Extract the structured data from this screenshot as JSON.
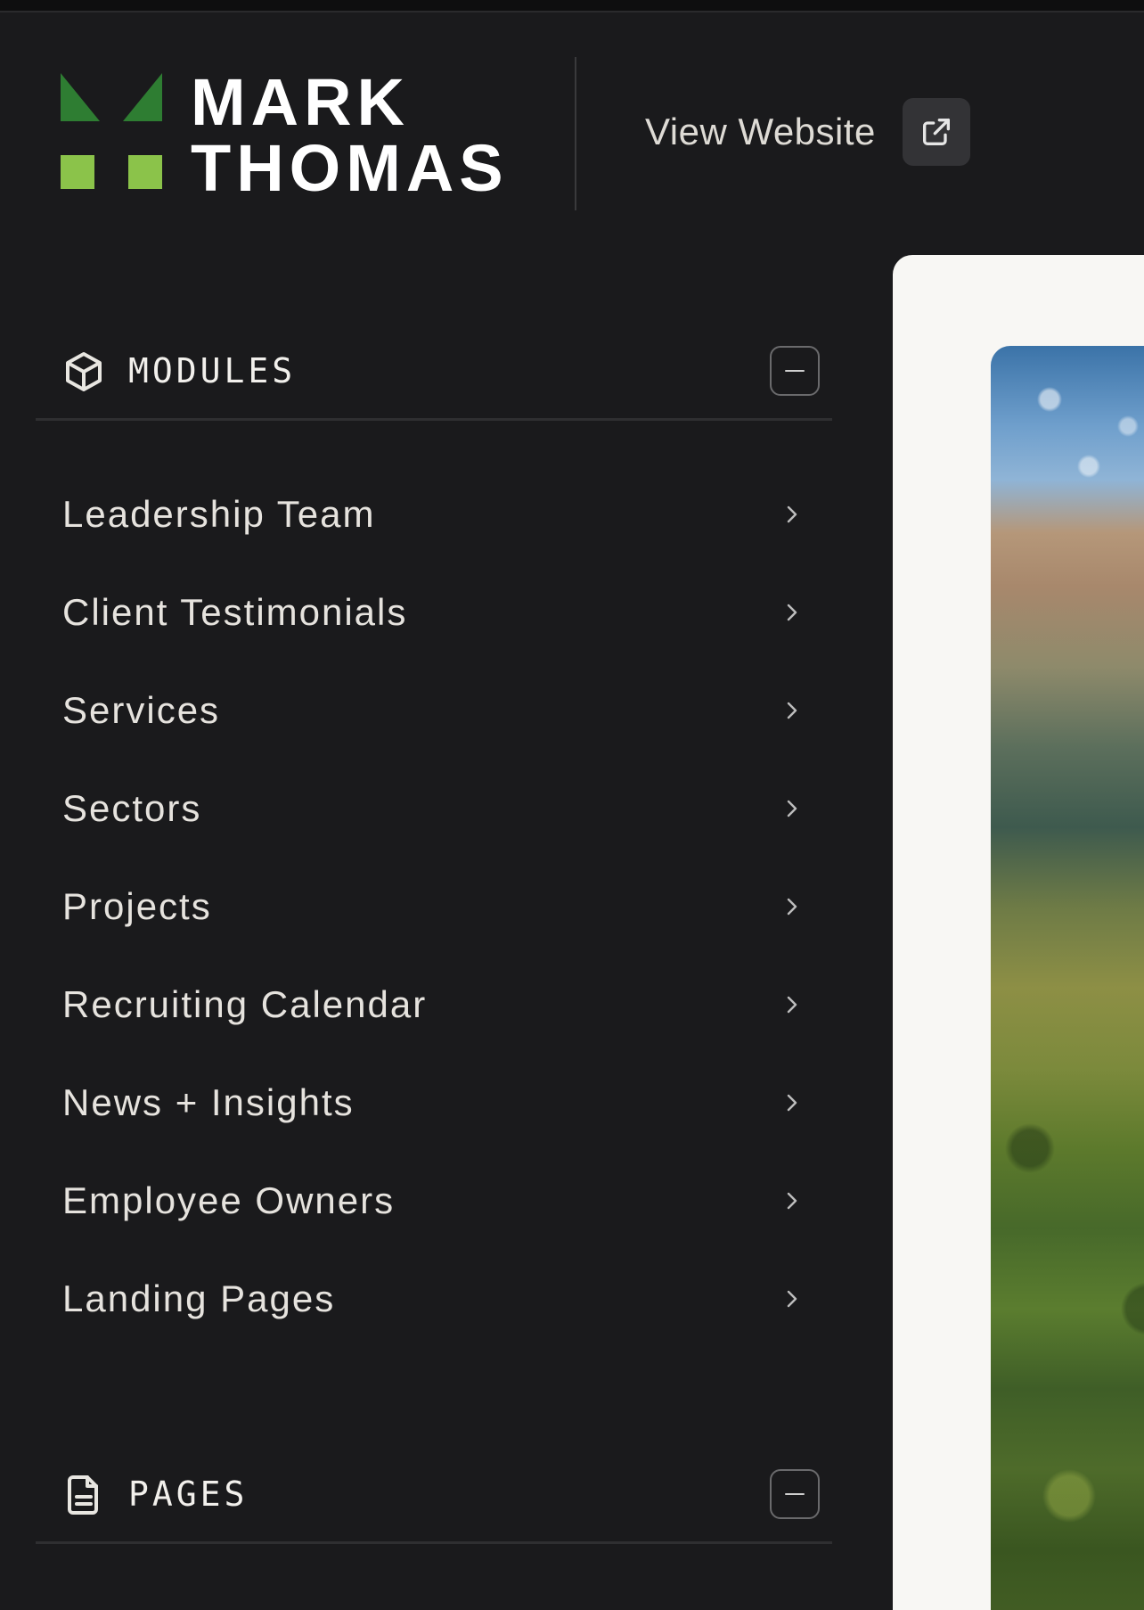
{
  "brand": {
    "name_line1": "MARK",
    "name_line2": "THOMAS",
    "colors": {
      "logo_dark_green": "#2e7d32",
      "logo_light_green": "#8bc34a"
    }
  },
  "header": {
    "view_website_label": "View Website",
    "external_link_icon": "external-link-icon"
  },
  "sections": {
    "modules": {
      "title": "MODULES",
      "icon": "cube-icon",
      "items": [
        {
          "label": "Leadership Team"
        },
        {
          "label": "Client Testimonials"
        },
        {
          "label": "Services"
        },
        {
          "label": "Sectors"
        },
        {
          "label": "Projects"
        },
        {
          "label": "Recruiting Calendar"
        },
        {
          "label": "News + Insights"
        },
        {
          "label": "Employee Owners"
        },
        {
          "label": "Landing Pages"
        }
      ]
    },
    "pages": {
      "title": "PAGES",
      "icon": "document-icon"
    }
  },
  "theme": {
    "sidebar_bg": "#1a1a1c",
    "panel_bg": "#f8f7f4",
    "text": "#e6e3de"
  }
}
